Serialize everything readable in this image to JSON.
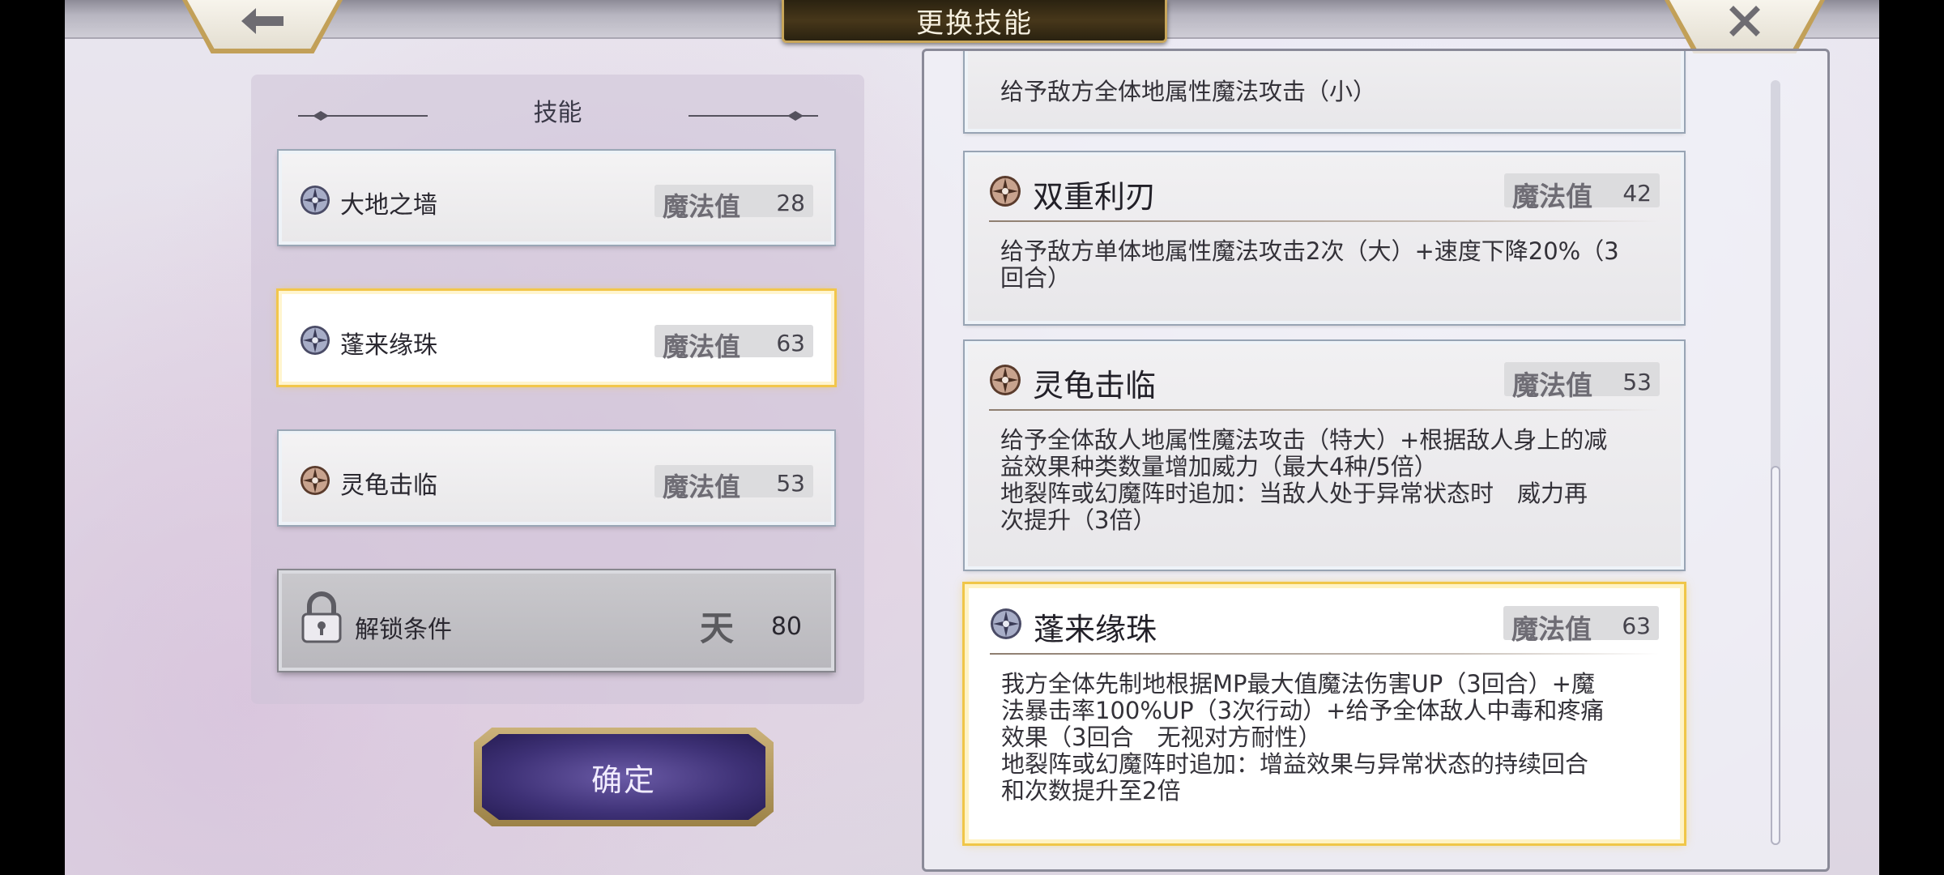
{
  "header": {
    "title": "更换技能"
  },
  "left_panel": {
    "title": "技能",
    "skills": [
      {
        "name": "大地之墙",
        "mp_label": "魔法值",
        "mp": "28",
        "icon": "compass-star-icon",
        "state": "normal"
      },
      {
        "name": "蓬来缘珠",
        "mp_label": "魔法值",
        "mp": "63",
        "icon": "compass-star-icon",
        "state": "selected"
      },
      {
        "name": "灵龟击临",
        "mp_label": "魔法值",
        "mp": "53",
        "icon": "compass-star-bronze-icon",
        "state": "normal"
      }
    ],
    "locked": {
      "label": "解锁条件",
      "glyph": "天",
      "value": "80"
    },
    "confirm_label": "确定"
  },
  "right_panel": {
    "partial_card_text": "给予敌方全体地属性魔法攻击（小）",
    "cards": [
      {
        "name": "双重利刃",
        "mp_label": "魔法值",
        "mp": "42",
        "text": "给予敌方单体地属性魔法攻击2次（大）+速度下降20%（3\n回合）"
      },
      {
        "name": "灵龟击临",
        "mp_label": "魔法值",
        "mp": "53",
        "text": "给予全体敌人地属性魔法攻击（特大）+根据敌人身上的减\n益效果种类数量增加威力（最大4种/5倍）\n地裂阵或幻魔阵时追加：当敌人处于异常状态时　威力再\n次提升（3倍）"
      },
      {
        "name": "蓬来缘珠",
        "mp_label": "魔法值",
        "mp": "63",
        "text": "我方全体先制地根据MP最大值魔法伤害UP（3回合）+魔\n法暴击率100%UP（3次行动）+给予全体敌人中毒和疼痛\n效果（3回合　无视对方耐性）\n地裂阵或幻魔阵时追加：增益效果与异常状态的持续回合\n和次数提升至2倍"
      }
    ]
  },
  "colors": {
    "selected_border": "#f2c64b",
    "confirm_button": "#3e3176",
    "title_plate": "#47371a"
  }
}
